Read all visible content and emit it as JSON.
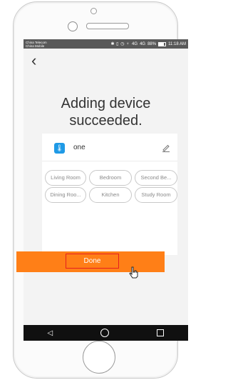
{
  "status_bar": {
    "carrier_1": "China Telecom",
    "carrier_2": "China Mobile",
    "network_1": "4G",
    "network_2": "4G",
    "battery": "88%",
    "time": "11:18 AM"
  },
  "nav": {
    "back_icon": "chevron-left-icon"
  },
  "title": "Adding device succeeded.",
  "device": {
    "name": "one",
    "icon": "thermometer-icon",
    "edit_icon": "pencil-icon"
  },
  "rooms": [
    "Living Room",
    "Bedroom",
    "Second Be...",
    "Dining Roo...",
    "Kitchen",
    "Study Room"
  ],
  "done_label": "Done",
  "system_nav": [
    "back-icon",
    "home-icon",
    "recent-apps-icon"
  ],
  "colors": {
    "accent": "#ff7f17",
    "device_icon": "#1f9ae6",
    "highlight_border": "#e51f1f"
  }
}
